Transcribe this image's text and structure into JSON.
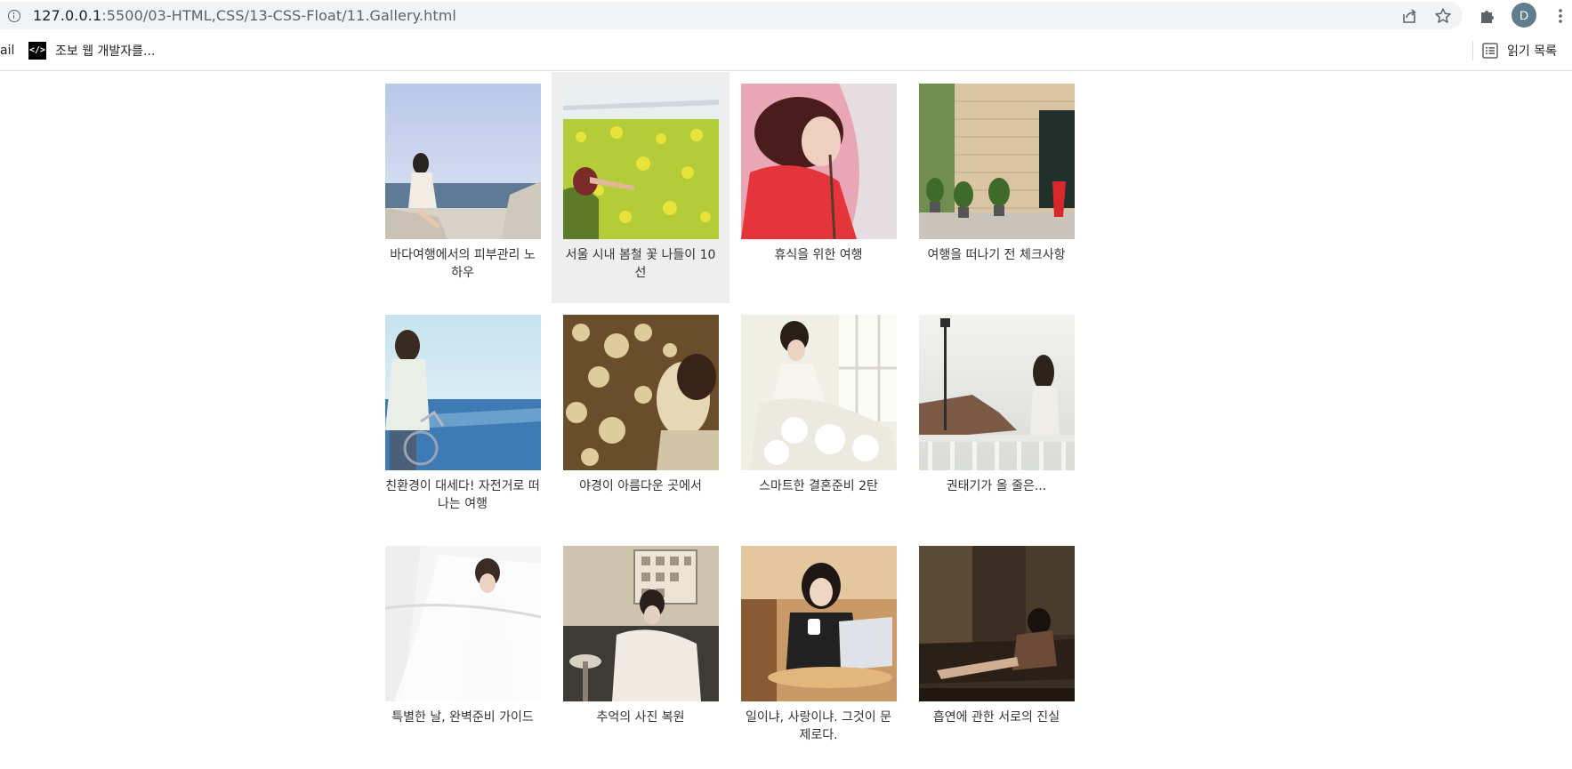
{
  "browser": {
    "url_host": "127.0.0.1",
    "url_path": ":5500/03-HTML,CSS/13-CSS-Float/11.Gallery.html",
    "profile_initial": "D"
  },
  "bookmarks": {
    "cut_label": "ail",
    "item_label": "조보 웹 개발자를...",
    "favicon_text": "</>",
    "reading_list_label": "읽기 목록"
  },
  "gallery": {
    "items": [
      {
        "caption": "바다여행에서의 피부관리 노하우",
        "icon": "beach-photo"
      },
      {
        "caption": "서울 시내 봄철 꽃 나들이 10선",
        "icon": "flower-field-photo"
      },
      {
        "caption": "휴식을 위한 여행",
        "icon": "sleeping-photo"
      },
      {
        "caption": "여행을 떠나기 전 체크사항",
        "icon": "brick-house-photo"
      },
      {
        "caption": "친환경이 대세다! 자전거로 떠나는 여행",
        "icon": "bicycle-sea-photo"
      },
      {
        "caption": "야경이 아름다운 곳에서",
        "icon": "night-lights-photo"
      },
      {
        "caption": "스마트한 결혼준비 2탄",
        "icon": "wedding-dress-photo"
      },
      {
        "caption": "권태기가 올 줄은...",
        "icon": "seaside-railing-photo"
      },
      {
        "caption": "특별한 날, 완벽준비 가이드",
        "icon": "bride-veil-photo"
      },
      {
        "caption": "추억의 사진 복원",
        "icon": "vintage-bride-photo"
      },
      {
        "caption": "일이냐, 사랑이냐. 그것이 문제로다.",
        "icon": "laptop-cafe-photo"
      },
      {
        "caption": "흡연에 관한 서로의 진실",
        "icon": "dark-room-photo"
      }
    ]
  }
}
